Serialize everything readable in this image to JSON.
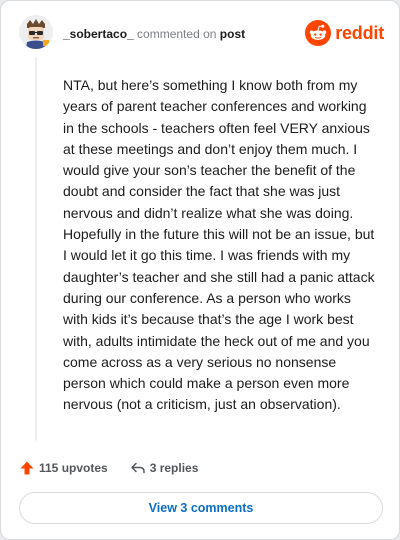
{
  "comment": {
    "username": "_sobertaco_",
    "commented_on_text": "commented on",
    "post_link": "post",
    "body": "NTA, but here’s something I know both from my years of parent teacher conferences and working in the schools - teachers often feel VERY anxious at these meetings and don’t enjoy them much. I would give your son’s teacher the benefit of the doubt and consider the fact that she was just nervous and didn’t realize what she was doing. Hopefully in the future this will not be an issue, but I would let it go this time. I was friends with my daughter’s teacher and she still had a panic attack during our conference. As a person who works with kids it’s because that’s the age I work best with, adults intimidate the heck out of me and you come across as a very serious no nonsense person which could make a person even more nervous (not a criticism, just an observation)."
  },
  "brand": {
    "name": "reddit",
    "icon": "reddit-logo-icon",
    "color": "#ff4500"
  },
  "actions": {
    "upvotes": "115 upvotes",
    "upvote_icon": "upvote-arrow-icon",
    "upvote_color": "#ff4500",
    "replies": "3 replies",
    "reply_icon": "reply-arrow-icon"
  },
  "view_comments_label": "View 3 comments",
  "colors": {
    "link_blue": "#0b6ec5",
    "text": "#1c1c1c",
    "muted": "#7c7f84"
  }
}
